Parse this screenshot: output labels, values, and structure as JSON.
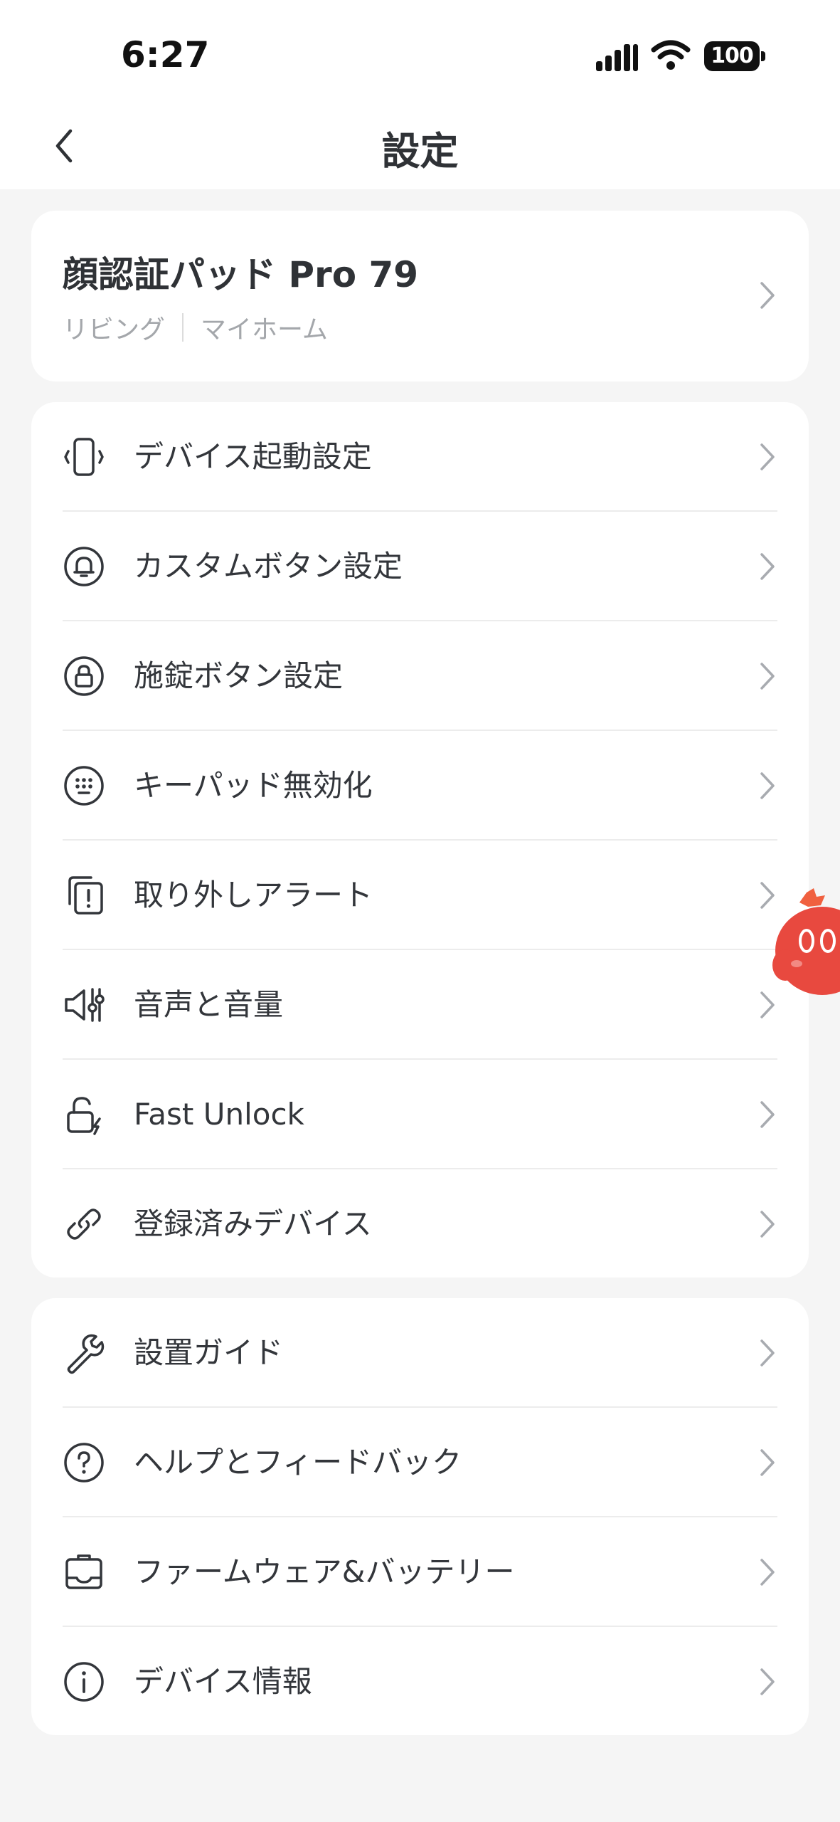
{
  "status_bar": {
    "time": "6:27",
    "battery": "100"
  },
  "header": {
    "title": "設定",
    "back_icon": "chevron-left-icon"
  },
  "device": {
    "name": "顔認証パッド Pro 79",
    "room": "リビング",
    "home": "マイホーム"
  },
  "settings": {
    "items": [
      {
        "label": "デバイス起動設定",
        "icon": "vibrate-phone-icon"
      },
      {
        "label": "カスタムボタン設定",
        "icon": "bell-button-icon"
      },
      {
        "label": "施錠ボタン設定",
        "icon": "lock-button-icon"
      },
      {
        "label": "キーパッド無効化",
        "icon": "keypad-icon"
      },
      {
        "label": "取り外しアラート",
        "icon": "tamper-alert-icon"
      },
      {
        "label": "音声と音量",
        "icon": "speaker-volume-icon"
      },
      {
        "label": "Fast Unlock",
        "icon": "fast-unlock-icon"
      },
      {
        "label": "登録済みデバイス",
        "icon": "link-icon"
      }
    ]
  },
  "support": {
    "items": [
      {
        "label": "設置ガイド",
        "icon": "wrench-icon"
      },
      {
        "label": "ヘルプとフィードバック",
        "icon": "help-circle-icon"
      },
      {
        "label": "ファームウェア&バッテリー",
        "icon": "firmware-icon"
      },
      {
        "label": "デバイス情報",
        "icon": "info-circle-icon"
      }
    ]
  },
  "colors": {
    "background": "#f5f5f5",
    "card": "#ffffff",
    "text": "#33363b",
    "secondary_text": "#a4a7ab",
    "chevron": "#a8abb0",
    "mascot": "#e8493f"
  }
}
